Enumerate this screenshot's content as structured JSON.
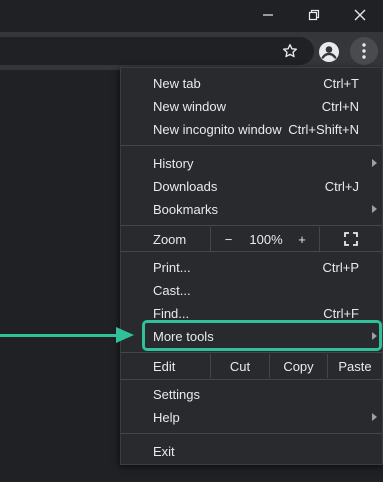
{
  "colors": {
    "background": "#202124",
    "toolbar": "#35363a",
    "menu_background": "#292a2d",
    "highlight_accent": "#2fc29a"
  },
  "titlebar": {
    "controls": [
      {
        "name": "minimize",
        "icon": "minimize-icon"
      },
      {
        "name": "restore",
        "icon": "restore-icon"
      },
      {
        "name": "close",
        "icon": "close-icon"
      }
    ]
  },
  "toolbar": {
    "bookmark_icon": "star-icon",
    "profile_icon": "account-icon",
    "menu_icon": "kebab-icon"
  },
  "menu": {
    "new_tab": {
      "label": "New tab",
      "shortcut": "Ctrl+T"
    },
    "new_window": {
      "label": "New window",
      "shortcut": "Ctrl+N"
    },
    "new_incognito": {
      "label": "New incognito window",
      "shortcut": "Ctrl+Shift+N"
    },
    "history": {
      "label": "History"
    },
    "downloads": {
      "label": "Downloads",
      "shortcut": "Ctrl+J"
    },
    "bookmarks": {
      "label": "Bookmarks"
    },
    "zoom": {
      "label": "Zoom",
      "minus": "−",
      "level": "100%",
      "plus": "+",
      "fullscreen_icon": "fullscreen-icon"
    },
    "print": {
      "label": "Print...",
      "shortcut": "Ctrl+P"
    },
    "cast": {
      "label": "Cast..."
    },
    "find": {
      "label": "Find...",
      "shortcut": "Ctrl+F"
    },
    "more_tools": {
      "label": "More tools"
    },
    "edit": {
      "label": "Edit",
      "cut": "Cut",
      "copy": "Copy",
      "paste": "Paste"
    },
    "settings": {
      "label": "Settings"
    },
    "help": {
      "label": "Help"
    },
    "exit": {
      "label": "Exit"
    }
  }
}
